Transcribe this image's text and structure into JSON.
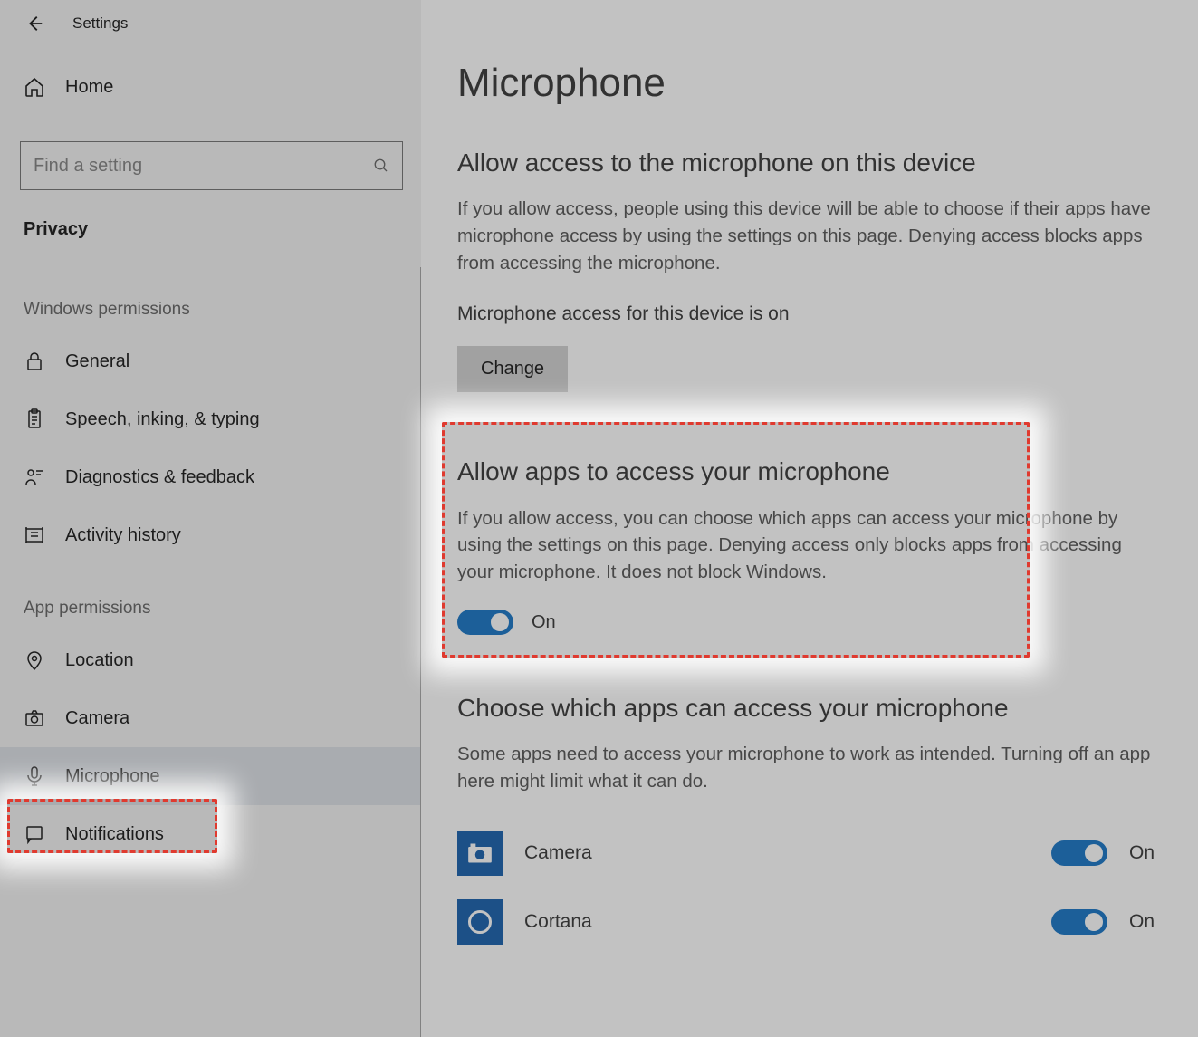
{
  "app_title": "Settings",
  "search": {
    "placeholder": "Find a setting"
  },
  "sidebar": {
    "home_label": "Home",
    "privacy_label": "Privacy",
    "group_windows": "Windows permissions",
    "group_app": "App permissions",
    "items_win": [
      {
        "label": "General"
      },
      {
        "label": "Speech, inking, & typing"
      },
      {
        "label": "Diagnostics & feedback"
      },
      {
        "label": "Activity history"
      }
    ],
    "items_app": [
      {
        "label": "Location"
      },
      {
        "label": "Camera"
      },
      {
        "label": "Microphone",
        "selected": true
      },
      {
        "label": "Notifications"
      }
    ]
  },
  "content": {
    "title": "Microphone",
    "sect1_h": "Allow access to the microphone on this device",
    "sect1_p": "If you allow access, people using this device will be able to choose if their apps have microphone access by using the settings on this page. Denying access blocks apps from accessing the microphone.",
    "status": "Microphone access for this device is on",
    "change_btn": "Change",
    "sect2_h": "Allow apps to access your microphone",
    "sect2_p": "If you allow access, you can choose which apps can access your microphone by using the settings on this page. Denying access only blocks apps from accessing your microphone. It does not block Windows.",
    "toggle_state": "On",
    "sect3_h": "Choose which apps can access your microphone",
    "sect3_p": "Some apps need to access your microphone to work as intended. Turning off an app here might limit what it can do.",
    "apps": [
      {
        "name": "Camera",
        "state": "On"
      },
      {
        "name": "Cortana",
        "state": "On"
      }
    ]
  }
}
